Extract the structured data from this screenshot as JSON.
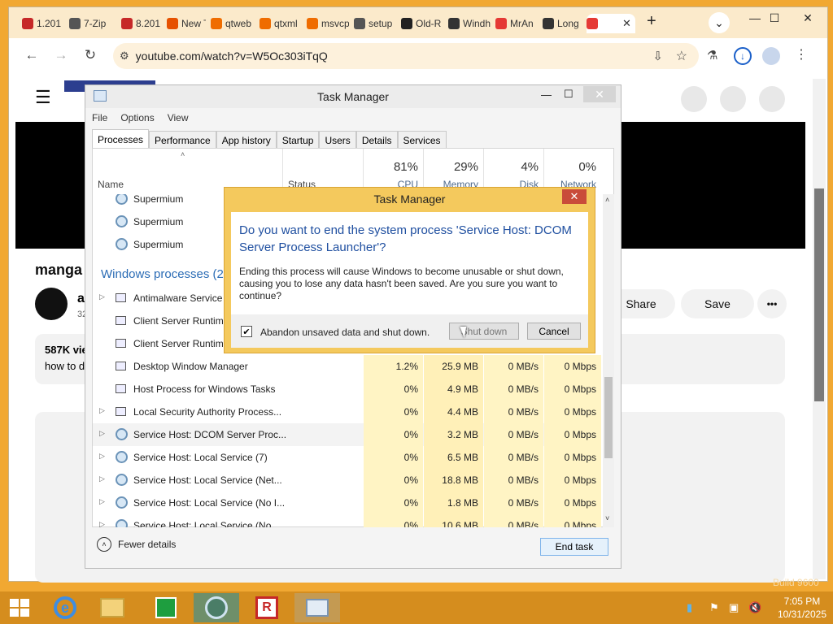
{
  "browser": {
    "tabs": [
      {
        "label": "1.201",
        "icon_color": "#c62828"
      },
      {
        "label": "7-Zip",
        "icon_color": "#555555"
      },
      {
        "label": "8.201",
        "icon_color": "#c62828"
      },
      {
        "label": "New T",
        "icon_color": "#e65100"
      },
      {
        "label": "qtweb",
        "icon_color": "#ef6c00"
      },
      {
        "label": "qtxml",
        "icon_color": "#ef6c00"
      },
      {
        "label": "msvcp",
        "icon_color": "#ef6c00"
      },
      {
        "label": "setup",
        "icon_color": "#555555"
      },
      {
        "label": "Old-R",
        "icon_color": "#222222"
      },
      {
        "label": "Windh",
        "icon_color": "#333333"
      },
      {
        "label": "MrAn",
        "icon_color": "#e53935"
      },
      {
        "label": "Long",
        "icon_color": "#333333"
      },
      {
        "label": "",
        "icon_color": "#e53935"
      }
    ],
    "active_tab_close": "✕",
    "new_tab": "+",
    "url": "youtube.com/watch?v=W5Oc303iTqQ",
    "window_controls": {
      "dropdown": "⌄",
      "minimize": "—",
      "maximize": "☐",
      "close": "✕"
    }
  },
  "youtube": {
    "title": "manga",
    "channel_initial": "a",
    "subs_fragment": "32",
    "views": "587K vie",
    "desc_fragment": "how to d",
    "share_label": "Share",
    "save_label": "Save",
    "more_label": "•••"
  },
  "task_manager": {
    "title": "Task Manager",
    "menu": [
      "File",
      "Options",
      "View"
    ],
    "tabs": [
      "Processes",
      "Performance",
      "App history",
      "Startup",
      "Users",
      "Details",
      "Services"
    ],
    "columns": {
      "name": "Name",
      "status": "Status",
      "cpu": {
        "pct": "81%",
        "label": "CPU"
      },
      "memory": {
        "pct": "29%",
        "label": "Memory"
      },
      "disk": {
        "pct": "4%",
        "label": "Disk"
      },
      "network": {
        "pct": "0%",
        "label": "Network"
      }
    },
    "supermium_rows": [
      "Supermium",
      "Supermium",
      "Supermium"
    ],
    "group_label": "Windows processes (2",
    "partial_rows": [
      "Antimalware Service E",
      "Client Server Runtime",
      "Client Server Runtime"
    ],
    "rows": [
      {
        "name": "Desktop Window Manager",
        "cpu": "1.2%",
        "mem": "25.9 MB",
        "disk": "0 MB/s",
        "net": "0 Mbps"
      },
      {
        "name": "Host Process for Windows Tasks",
        "cpu": "0%",
        "mem": "4.9 MB",
        "disk": "0 MB/s",
        "net": "0 Mbps"
      },
      {
        "name": "Local Security Authority Process...",
        "cpu": "0%",
        "mem": "4.4 MB",
        "disk": "0 MB/s",
        "net": "0 Mbps"
      },
      {
        "name": "Service Host: DCOM Server Proc...",
        "cpu": "0%",
        "mem": "3.2 MB",
        "disk": "0 MB/s",
        "net": "0 Mbps"
      },
      {
        "name": "Service Host: Local Service (7)",
        "cpu": "0%",
        "mem": "6.5 MB",
        "disk": "0 MB/s",
        "net": "0 Mbps"
      },
      {
        "name": "Service Host: Local Service (Net...",
        "cpu": "0%",
        "mem": "18.8 MB",
        "disk": "0 MB/s",
        "net": "0 Mbps"
      },
      {
        "name": "Service Host: Local Service (No I...",
        "cpu": "0%",
        "mem": "1.8 MB",
        "disk": "0 MB/s",
        "net": "0 Mbps"
      },
      {
        "name": "Service Host: Local Service (No ...",
        "cpu": "0%",
        "mem": "10.6 MB",
        "disk": "0 MB/s",
        "net": "0 Mbps"
      }
    ],
    "fewer_details": "Fewer details",
    "end_task": "End task"
  },
  "dialog": {
    "title": "Task Manager",
    "close": "✕",
    "main_text": "Do you want to end the system process 'Service Host: DCOM Server Process Launcher'?",
    "sub_text": "Ending this process will cause Windows to become unusable or shut down, causing you to lose any data hasn't been saved. Are you sure you want to continue?",
    "checkbox_label": "Abandon unsaved data and shut down.",
    "checkbox_checked": true,
    "shutdown_label": "Shut down",
    "cancel_label": "Cancel"
  },
  "taskbar": {
    "time": "7:05 PM",
    "date": "10/31/2025",
    "build": "Build 9600"
  }
}
